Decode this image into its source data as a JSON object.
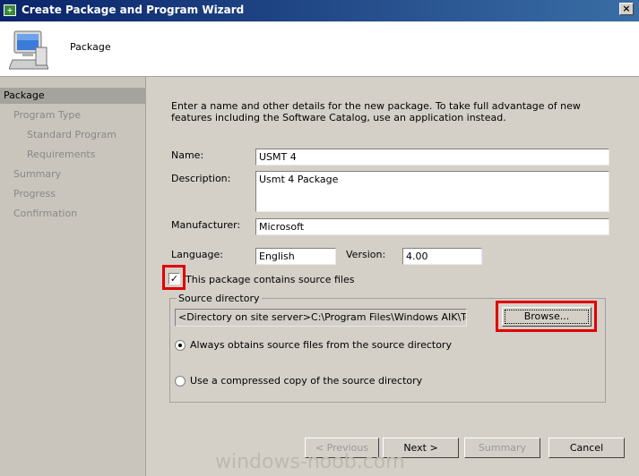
{
  "window": {
    "title": "Create Package and Program Wizard",
    "app_icon_glyph": "+",
    "close_glyph": "×"
  },
  "header": {
    "title": "Package",
    "icon": "computer-icon"
  },
  "sidebar": {
    "items": [
      {
        "label": "Package",
        "active": true
      },
      {
        "label": "Program Type"
      },
      {
        "label": "Standard Program"
      },
      {
        "label": "Requirements"
      },
      {
        "label": "Summary"
      },
      {
        "label": "Progress"
      },
      {
        "label": "Confirmation"
      }
    ]
  },
  "main": {
    "intro": "Enter a name and other details for the new package. To take full advantage of new features including the Software Catalog, use an application instead.",
    "name_label": "Name:",
    "name_value": "USMT 4",
    "description_label": "Description:",
    "description_value": "Usmt 4 Package",
    "manufacturer_label": "Manufacturer:",
    "manufacturer_value": "Microsoft",
    "language_label": "Language:",
    "language_value": "English",
    "version_label": "Version:",
    "version_value": "4.00",
    "source_checkbox_label": "This package contains source files",
    "source_checkbox_checked": true,
    "check_glyph": "✓",
    "source_group_title": "Source directory",
    "source_path": "<Directory on site server>C:\\Program Files\\Windows AIK\\Tools\\USMT",
    "browse_label": "Browse...",
    "radio_always": "Always obtains source files from the source directory",
    "radio_compressed": "Use a compressed copy of the source directory",
    "selected_radio": "always"
  },
  "footer": {
    "previous_label": "< Previous",
    "next_label": "Next >",
    "summary_label": "Summary",
    "cancel_label": "Cancel"
  },
  "watermark": "windows-noob.com",
  "colors": {
    "title_gradient_start": "#0a246a",
    "title_gradient_end": "#3a6ea5",
    "highlight_red": "#e00000",
    "active_nav": "#a5a39e"
  }
}
